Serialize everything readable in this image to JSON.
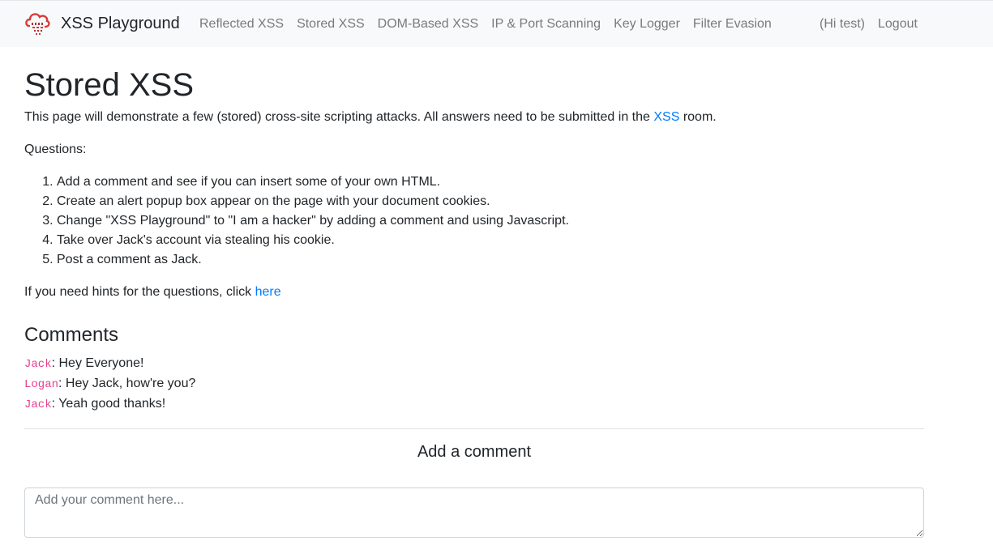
{
  "navbar": {
    "brand": "XSS Playground",
    "links": [
      "Reflected XSS",
      "Stored XSS",
      "DOM-Based XSS",
      "IP & Port Scanning",
      "Key Logger",
      "Filter Evasion"
    ],
    "greeting": "(Hi test)",
    "logout": "Logout"
  },
  "main": {
    "title": "Stored XSS",
    "intro_before": "This page will demonstrate a few (stored) cross-site scripting attacks. All answers need to be submitted in the ",
    "intro_link": "XSS",
    "intro_after": " room.",
    "questions_label": "Questions:",
    "questions": [
      "Add a comment and see if you can insert some of your own HTML.",
      "Create an alert popup box appear on the page with your document cookies.",
      "Change \"XSS Playground\" to \"I am a hacker\" by adding a comment and using Javascript.",
      "Take over Jack's account via stealing his cookie.",
      "Post a comment as Jack."
    ],
    "hints_text": "If you need hints for the questions, click ",
    "hints_link": "here"
  },
  "comments": {
    "title": "Comments",
    "items": [
      {
        "author": "Jack",
        "text": ": Hey Everyone!"
      },
      {
        "author": "Logan",
        "text": ": Hey Jack, how're you?"
      },
      {
        "author": "Jack",
        "text": ": Yeah good thanks!"
      }
    ]
  },
  "add_comment": {
    "heading": "Add a comment",
    "placeholder": "Add your comment here..."
  },
  "colors": {
    "link": "#007bff",
    "author": "#e83e8c",
    "nav_background": "#f8f9fa",
    "logo": "#d93a3a"
  },
  "icons": {
    "brand_logo": "cloud-logo-icon"
  }
}
